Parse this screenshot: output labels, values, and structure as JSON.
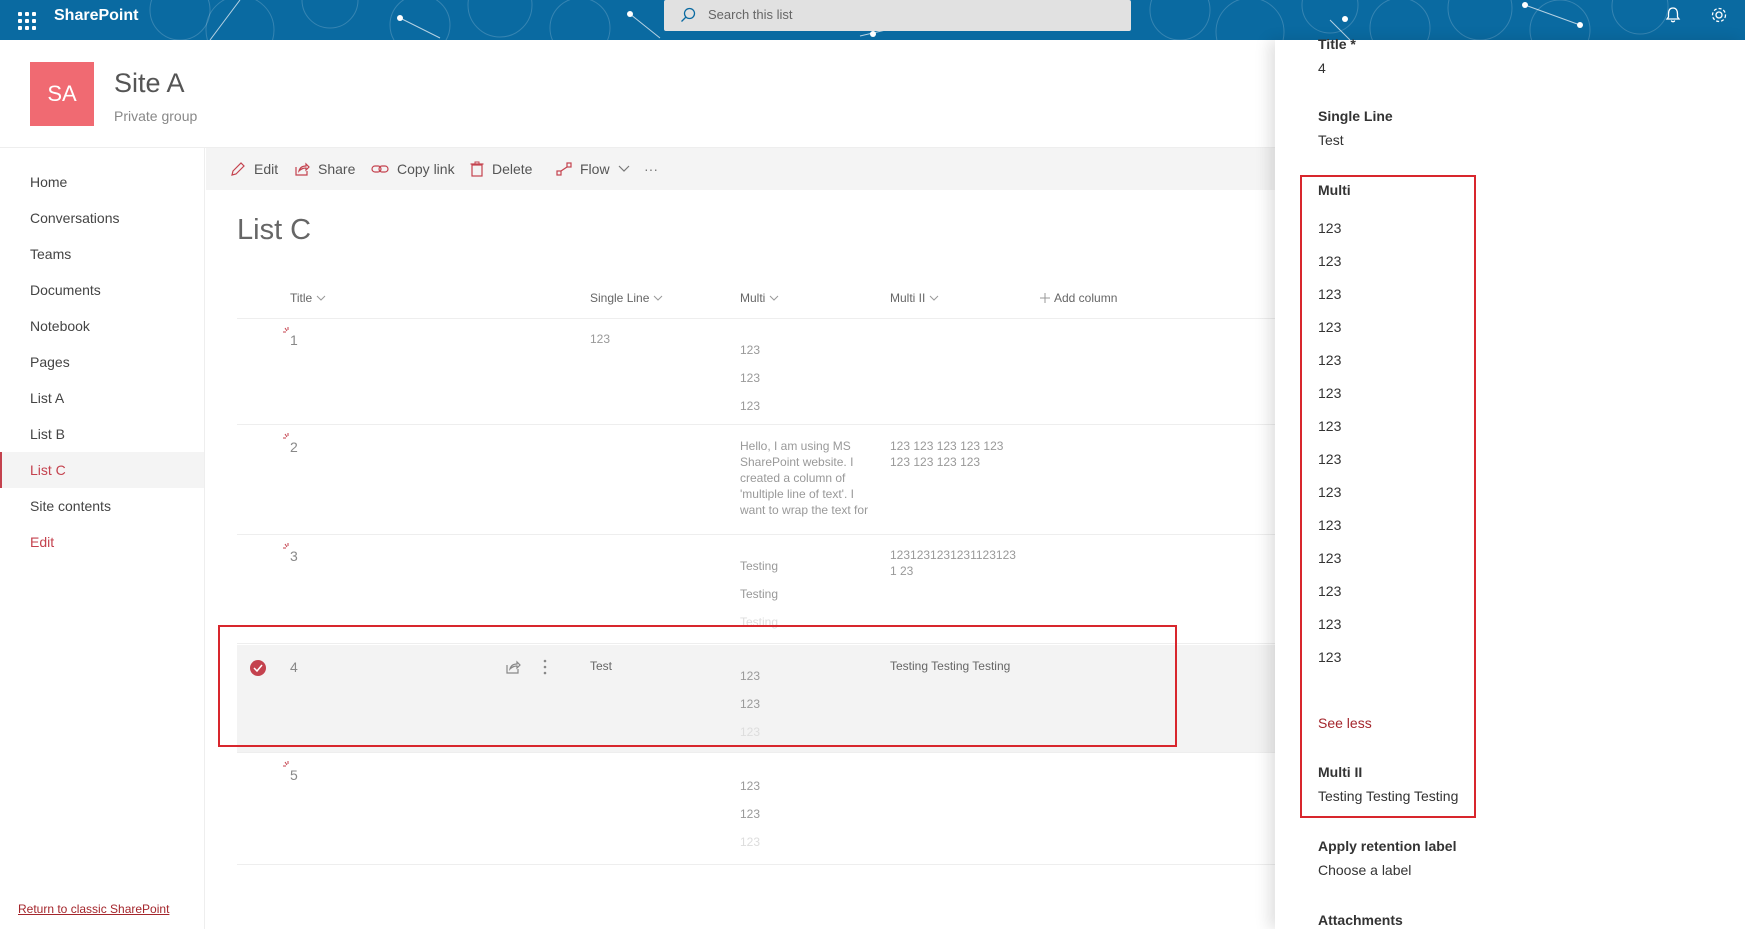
{
  "suitebar": {
    "app_name": "SharePoint",
    "search_placeholder": "Search this list"
  },
  "site": {
    "logo_initials": "SA",
    "title": "Site A",
    "subtitle": "Private group"
  },
  "nav": {
    "items": [
      {
        "label": "Home"
      },
      {
        "label": "Conversations"
      },
      {
        "label": "Teams"
      },
      {
        "label": "Documents"
      },
      {
        "label": "Notebook"
      },
      {
        "label": "Pages"
      },
      {
        "label": "List A"
      },
      {
        "label": "List B"
      },
      {
        "label": "List C",
        "selected": true
      },
      {
        "label": "Site contents"
      },
      {
        "label": "Edit"
      }
    ],
    "classic_link": "Return to classic SharePoint"
  },
  "commands": {
    "edit": "Edit",
    "share": "Share",
    "copy_link": "Copy link",
    "delete": "Delete",
    "flow": "Flow",
    "more": "···"
  },
  "list": {
    "title": "List C",
    "columns": {
      "title": "Title",
      "single_line": "Single Line",
      "multi": "Multi",
      "multi_ii": "Multi II",
      "add_column": "Add column"
    },
    "rows": [
      {
        "title": "1",
        "single": "123",
        "multi": [
          "123",
          "123",
          "123"
        ],
        "multi_ii": ""
      },
      {
        "title": "2",
        "single": "",
        "multi_text": "Hello, I am using MS SharePoint website. I created a column of 'multiple line of text'. I want to wrap the text for",
        "multi_ii": "123 123 123 123 123 123 123 123 123"
      },
      {
        "title": "3",
        "single": "",
        "multi": [
          "Testing",
          "Testing",
          "Testing"
        ],
        "multi_ii": "12312312312311231231 23"
      },
      {
        "title": "4",
        "single": "Test",
        "multi": [
          "123",
          "123",
          "123"
        ],
        "multi_ii": "Testing Testing Testing",
        "selected": true
      },
      {
        "title": "5",
        "single": "",
        "multi": [
          "123",
          "123",
          "123"
        ],
        "multi_ii": ""
      }
    ]
  },
  "panel": {
    "title_label": "Title *",
    "title_value": "4",
    "single_label": "Single Line",
    "single_value": "Test",
    "multi_label": "Multi",
    "multi_lines": [
      "123",
      "123",
      "123",
      "123",
      "123",
      "123",
      "123",
      "123",
      "123",
      "123",
      "123",
      "123",
      "123",
      "123"
    ],
    "see_less": "See less",
    "multi_ii_label": "Multi II",
    "multi_ii_value": "Testing Testing Testing",
    "retention_label": "Apply retention label",
    "retention_value": "Choose a label",
    "attachments_label": "Attachments"
  },
  "colors": {
    "suitebar": "#0a6aa1",
    "accent": "#c4424e",
    "highlight": "#d8262d",
    "site_logo": "#f06a72"
  }
}
